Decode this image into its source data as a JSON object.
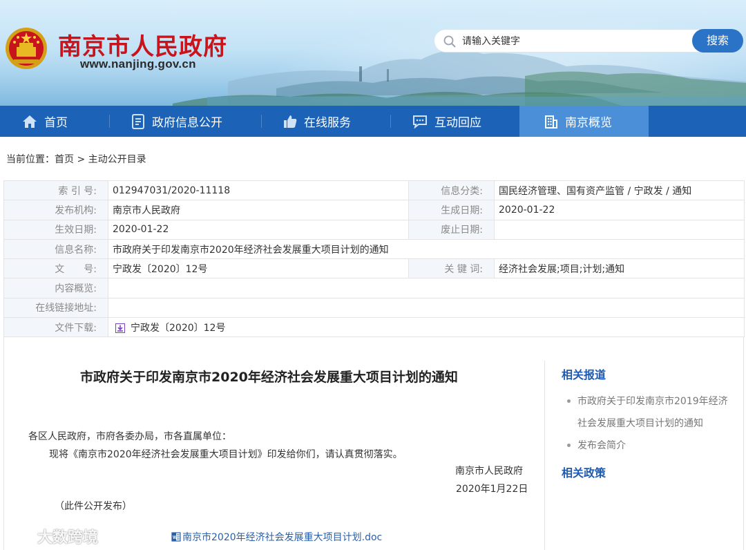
{
  "header": {
    "title": "南京市人民政府",
    "url": "www.nanjing.gov.cn",
    "search_placeholder": "请输入关键字",
    "search_button": "搜索",
    "emblem_icon": "national-emblem-icon"
  },
  "nav": {
    "items": [
      {
        "label": "首页",
        "icon": "home-icon"
      },
      {
        "label": "政府信息公开",
        "icon": "document-list-icon"
      },
      {
        "label": "在线服务",
        "icon": "thumbs-up-icon"
      },
      {
        "label": "互动回应",
        "icon": "chat-bubble-icon"
      },
      {
        "label": "南京概览",
        "icon": "building-icon"
      }
    ],
    "active_index": 4
  },
  "breadcrumb": {
    "prefix": "当前位置：",
    "home": "首页",
    "separator": ">",
    "current": "主动公开目录"
  },
  "meta": {
    "index_label": "索 引 号:",
    "index_value": "012947031/2020-11118",
    "category_label": "信息分类:",
    "category_value": "国民经济管理、国有资产监管 / 宁政发 / 通知",
    "publisher_label": "发布机构:",
    "publisher_value": "南京市人民政府",
    "created_label": "生成日期:",
    "created_value": "2020-01-22",
    "effective_label": "生效日期:",
    "effective_value": "2020-01-22",
    "abolished_label": "废止日期:",
    "abolished_value": "",
    "name_label": "信息名称:",
    "name_value": "市政府关于印发南京市2020年经济社会发展重大项目计划的通知",
    "docno_label": "文　　号:",
    "docno_value": "宁政发〔2020〕12号",
    "keywords_label": "关 键 词:",
    "keywords_value": "经济社会发展;项目;计划;通知",
    "summary_label": "内容概览:",
    "summary_value": "",
    "link_label": "在线链接地址:",
    "link_value": "",
    "download_label": "文件下载:",
    "download_value": "宁政发〔2020〕12号"
  },
  "document": {
    "title": "市政府关于印发南京市2020年经济社会发展重大项目计划的通知",
    "addressee": "各区人民政府，市府各委办局，市各直属单位：",
    "body": "现将《南京市2020年经济社会发展重大项目计划》印发给你们，请认真贯彻落实。",
    "sign_org": "南京市人民政府",
    "sign_date": "2020年1月22日",
    "pub_note": "（此件公开发布）",
    "attachment": "南京市2020年经济社会发展重大项目计划.doc"
  },
  "sidebar": {
    "related_reports_title": "相关报道",
    "related_reports": [
      "市政府关于印发南京市2019年经济社会发展重大项目计划的通知",
      "发布会简介"
    ],
    "related_policies_title": "相关政策"
  },
  "watermark": {
    "text": "大数跨境",
    "icon": "watermark-logo-icon"
  },
  "colors": {
    "title_red": "#c8141c",
    "nav_blue": "#1c63b8",
    "nav_active": "#4b8fd8",
    "link_blue": "#1e5bb0",
    "search_button": "#2a73c7"
  }
}
